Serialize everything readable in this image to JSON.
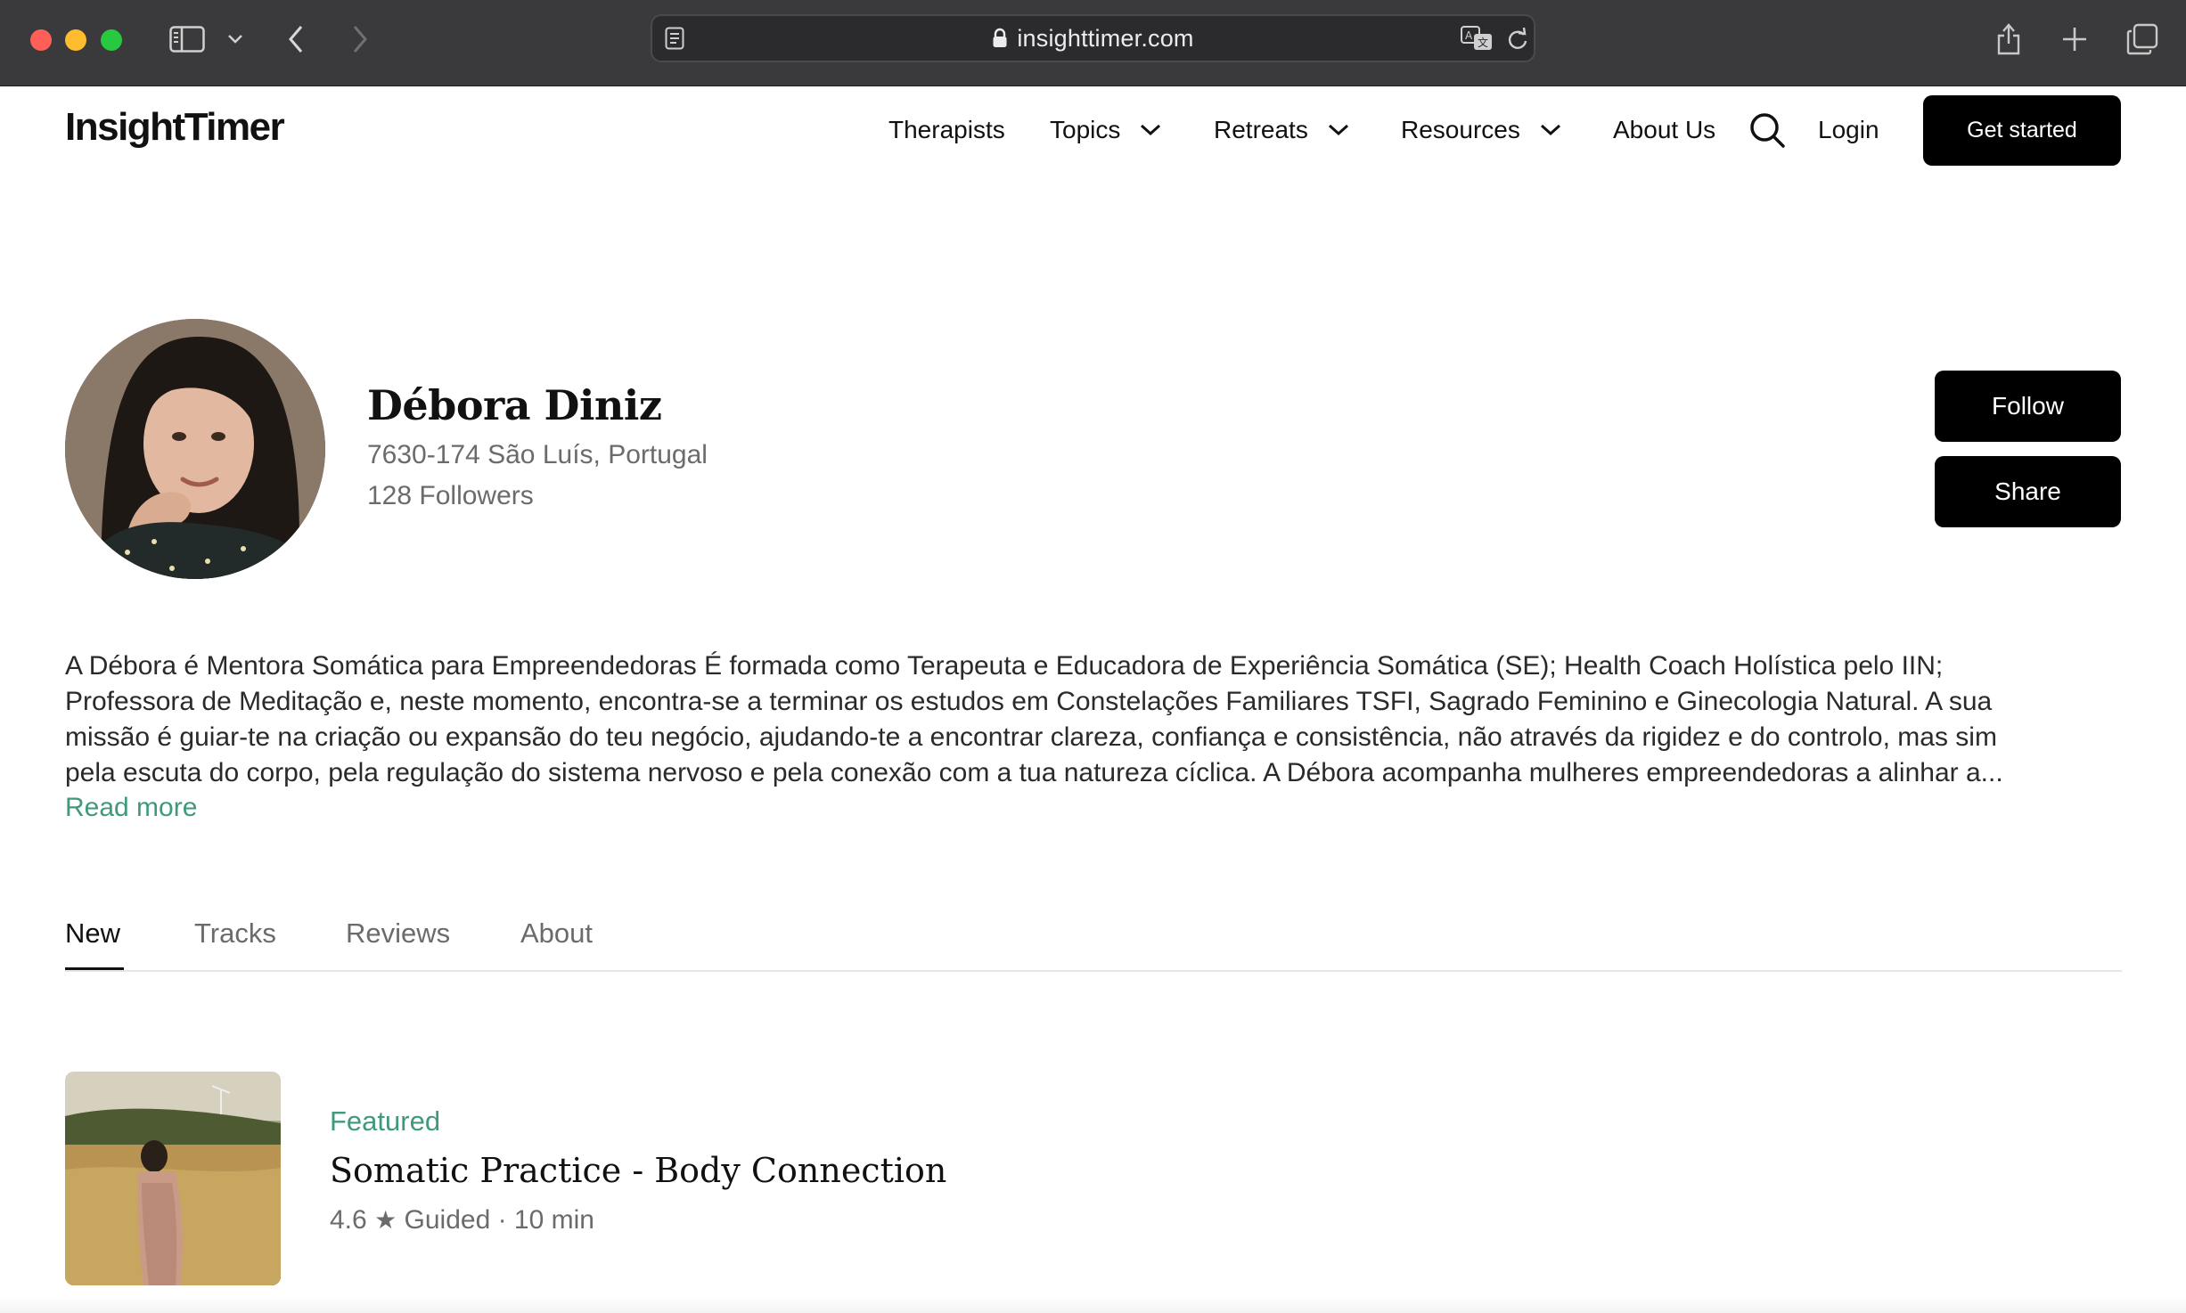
{
  "browser": {
    "url": "insighttimer.com"
  },
  "header": {
    "logo": "InsightTimer",
    "nav": [
      {
        "label": "Therapists"
      },
      {
        "label": "Topics"
      },
      {
        "label": "Retreats"
      },
      {
        "label": "Resources"
      },
      {
        "label": "About Us"
      }
    ],
    "login": "Login",
    "cta": "Get started"
  },
  "profile": {
    "name": "Débora Diniz",
    "location": "7630-174 São Luís, Portugal",
    "followers": "128 Followers",
    "follow_label": "Follow",
    "share_label": "Share",
    "bio_lines": [
      "A Débora é Mentora Somática para Empreendedoras É formada como Terapeuta e Educadora de Experiência Somática (SE); Health Coach Holística pelo IIN;",
      "Professora de Meditação e, neste momento, encontra-se a terminar os estudos em Constelações Familiares TSFI, Sagrado Feminino e Ginecologia Natural. A sua",
      "missão é guiar-te na criação ou expansão do teu negócio, ajudando-te a encontrar clareza, confiança e consistência, não através da rigidez e do controlo, mas sim",
      "pela escuta do corpo, pela regulação do sistema nervoso e pela conexão com a tua natureza cíclica. A Débora acompanha mulheres empreendedoras a alinhar a..."
    ],
    "read_more": "Read more"
  },
  "tabs": [
    {
      "label": "New",
      "active": true
    },
    {
      "label": "Tracks",
      "active": false
    },
    {
      "label": "Reviews",
      "active": false
    },
    {
      "label": "About",
      "active": false
    }
  ],
  "track": {
    "badge": "Featured",
    "title": "Somatic Practice - Body Connection",
    "rating": "4.6",
    "meta": "Guided · 10 min"
  },
  "colors": {
    "accent_green": "#3e9a7a",
    "chrome_bg": "#3a3a3c",
    "button_black": "#000000"
  }
}
